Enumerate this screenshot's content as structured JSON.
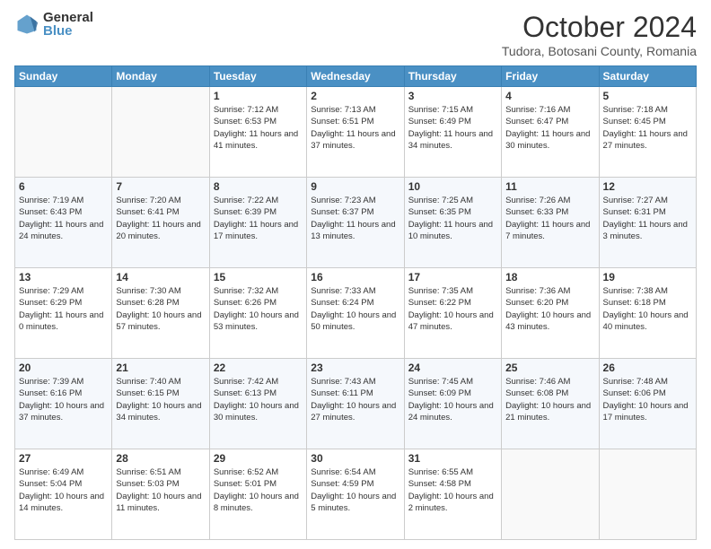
{
  "logo": {
    "general": "General",
    "blue": "Blue"
  },
  "title": "October 2024",
  "location": "Tudora, Botosani County, Romania",
  "days_header": [
    "Sunday",
    "Monday",
    "Tuesday",
    "Wednesday",
    "Thursday",
    "Friday",
    "Saturday"
  ],
  "weeks": [
    [
      {
        "num": "",
        "info": ""
      },
      {
        "num": "",
        "info": ""
      },
      {
        "num": "1",
        "info": "Sunrise: 7:12 AM\nSunset: 6:53 PM\nDaylight: 11 hours and 41 minutes."
      },
      {
        "num": "2",
        "info": "Sunrise: 7:13 AM\nSunset: 6:51 PM\nDaylight: 11 hours and 37 minutes."
      },
      {
        "num": "3",
        "info": "Sunrise: 7:15 AM\nSunset: 6:49 PM\nDaylight: 11 hours and 34 minutes."
      },
      {
        "num": "4",
        "info": "Sunrise: 7:16 AM\nSunset: 6:47 PM\nDaylight: 11 hours and 30 minutes."
      },
      {
        "num": "5",
        "info": "Sunrise: 7:18 AM\nSunset: 6:45 PM\nDaylight: 11 hours and 27 minutes."
      }
    ],
    [
      {
        "num": "6",
        "info": "Sunrise: 7:19 AM\nSunset: 6:43 PM\nDaylight: 11 hours and 24 minutes."
      },
      {
        "num": "7",
        "info": "Sunrise: 7:20 AM\nSunset: 6:41 PM\nDaylight: 11 hours and 20 minutes."
      },
      {
        "num": "8",
        "info": "Sunrise: 7:22 AM\nSunset: 6:39 PM\nDaylight: 11 hours and 17 minutes."
      },
      {
        "num": "9",
        "info": "Sunrise: 7:23 AM\nSunset: 6:37 PM\nDaylight: 11 hours and 13 minutes."
      },
      {
        "num": "10",
        "info": "Sunrise: 7:25 AM\nSunset: 6:35 PM\nDaylight: 11 hours and 10 minutes."
      },
      {
        "num": "11",
        "info": "Sunrise: 7:26 AM\nSunset: 6:33 PM\nDaylight: 11 hours and 7 minutes."
      },
      {
        "num": "12",
        "info": "Sunrise: 7:27 AM\nSunset: 6:31 PM\nDaylight: 11 hours and 3 minutes."
      }
    ],
    [
      {
        "num": "13",
        "info": "Sunrise: 7:29 AM\nSunset: 6:29 PM\nDaylight: 11 hours and 0 minutes."
      },
      {
        "num": "14",
        "info": "Sunrise: 7:30 AM\nSunset: 6:28 PM\nDaylight: 10 hours and 57 minutes."
      },
      {
        "num": "15",
        "info": "Sunrise: 7:32 AM\nSunset: 6:26 PM\nDaylight: 10 hours and 53 minutes."
      },
      {
        "num": "16",
        "info": "Sunrise: 7:33 AM\nSunset: 6:24 PM\nDaylight: 10 hours and 50 minutes."
      },
      {
        "num": "17",
        "info": "Sunrise: 7:35 AM\nSunset: 6:22 PM\nDaylight: 10 hours and 47 minutes."
      },
      {
        "num": "18",
        "info": "Sunrise: 7:36 AM\nSunset: 6:20 PM\nDaylight: 10 hours and 43 minutes."
      },
      {
        "num": "19",
        "info": "Sunrise: 7:38 AM\nSunset: 6:18 PM\nDaylight: 10 hours and 40 minutes."
      }
    ],
    [
      {
        "num": "20",
        "info": "Sunrise: 7:39 AM\nSunset: 6:16 PM\nDaylight: 10 hours and 37 minutes."
      },
      {
        "num": "21",
        "info": "Sunrise: 7:40 AM\nSunset: 6:15 PM\nDaylight: 10 hours and 34 minutes."
      },
      {
        "num": "22",
        "info": "Sunrise: 7:42 AM\nSunset: 6:13 PM\nDaylight: 10 hours and 30 minutes."
      },
      {
        "num": "23",
        "info": "Sunrise: 7:43 AM\nSunset: 6:11 PM\nDaylight: 10 hours and 27 minutes."
      },
      {
        "num": "24",
        "info": "Sunrise: 7:45 AM\nSunset: 6:09 PM\nDaylight: 10 hours and 24 minutes."
      },
      {
        "num": "25",
        "info": "Sunrise: 7:46 AM\nSunset: 6:08 PM\nDaylight: 10 hours and 21 minutes."
      },
      {
        "num": "26",
        "info": "Sunrise: 7:48 AM\nSunset: 6:06 PM\nDaylight: 10 hours and 17 minutes."
      }
    ],
    [
      {
        "num": "27",
        "info": "Sunrise: 6:49 AM\nSunset: 5:04 PM\nDaylight: 10 hours and 14 minutes."
      },
      {
        "num": "28",
        "info": "Sunrise: 6:51 AM\nSunset: 5:03 PM\nDaylight: 10 hours and 11 minutes."
      },
      {
        "num": "29",
        "info": "Sunrise: 6:52 AM\nSunset: 5:01 PM\nDaylight: 10 hours and 8 minutes."
      },
      {
        "num": "30",
        "info": "Sunrise: 6:54 AM\nSunset: 4:59 PM\nDaylight: 10 hours and 5 minutes."
      },
      {
        "num": "31",
        "info": "Sunrise: 6:55 AM\nSunset: 4:58 PM\nDaylight: 10 hours and 2 minutes."
      },
      {
        "num": "",
        "info": ""
      },
      {
        "num": "",
        "info": ""
      }
    ]
  ]
}
